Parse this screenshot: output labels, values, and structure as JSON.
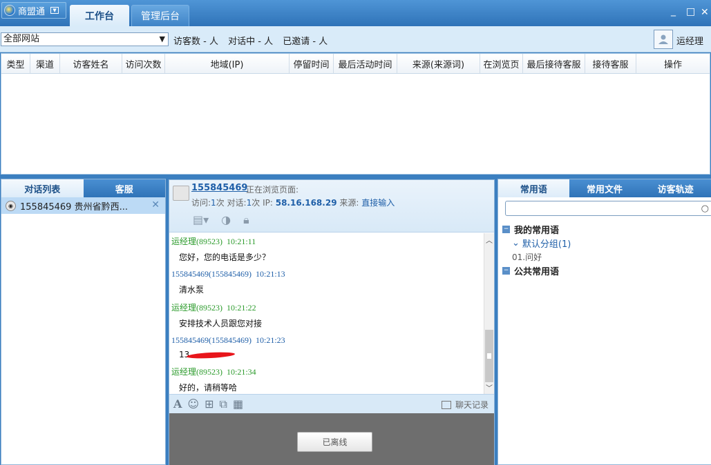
{
  "app": {
    "name": "商盟通",
    "dropdown_glyph": "▼"
  },
  "tabs": [
    {
      "label": "工作台"
    },
    {
      "label": "管理后台"
    }
  ],
  "window_controls": {
    "minimize": "_",
    "maximize": "□",
    "close": "✕"
  },
  "toolbar": {
    "site_select": "全部网站",
    "visitors": "访客数 - 人",
    "chatting": "对话中 - 人",
    "invited": "已邀请 - 人",
    "user_name": "运经理"
  },
  "table": {
    "columns": [
      "类型",
      "渠道",
      "访客姓名",
      "访问次数",
      "地域(IP)",
      "停留时间",
      "最后活动时间",
      "来源(来源词)",
      "在浏览页",
      "最后接待客服",
      "接待客服",
      "操作"
    ]
  },
  "left_panel": {
    "tabs": [
      "对话列表",
      "客服"
    ],
    "conversations": [
      {
        "label": "155845469 贵州省黔西..."
      }
    ]
  },
  "chat": {
    "visitor_id": "155845469",
    "browsing_label": "正在浏览页面:",
    "visit_label": "访问:",
    "visit_count": "1",
    "times_unit": "次",
    "dialog_label": "对话:",
    "dialog_count": "1",
    "ip_label": "IP:",
    "ip": "58.16.168.29",
    "source_label": "来源:",
    "source": "直接输入",
    "messages": [
      {
        "sender": "运经理(89523)",
        "time": "10:21:11",
        "text": "您好，您的电话是多少？",
        "role": "agent"
      },
      {
        "sender": "155845469(155845469)",
        "time": "10:21:13",
        "text": "清水泵",
        "role": "visitor"
      },
      {
        "sender": "运经理(89523)",
        "time": "10:21:22",
        "text": "安排技术人员跟您对接",
        "role": "agent"
      },
      {
        "sender": "155845469(155845469)",
        "time": "10:21:23",
        "text": "13",
        "role": "visitor"
      },
      {
        "sender": "运经理(89523)",
        "time": "10:21:34",
        "text": "好的，请稍等哈",
        "role": "agent"
      }
    ],
    "history_label": "聊天记录",
    "offline_button": "已离线"
  },
  "right_panel": {
    "tabs": [
      "常用语",
      "常用文件",
      "访客轨迹"
    ],
    "search_placeholder": "",
    "my_phrases": "我的常用语",
    "default_group": "默认分组(1)",
    "phrase_item": "01.问好",
    "public_phrases": "公共常用语"
  },
  "colors": {
    "accent": "#2f73b8",
    "agent": "#2a9a2a",
    "visitor": "#1f5fa8",
    "redaction": "#e8151b"
  }
}
